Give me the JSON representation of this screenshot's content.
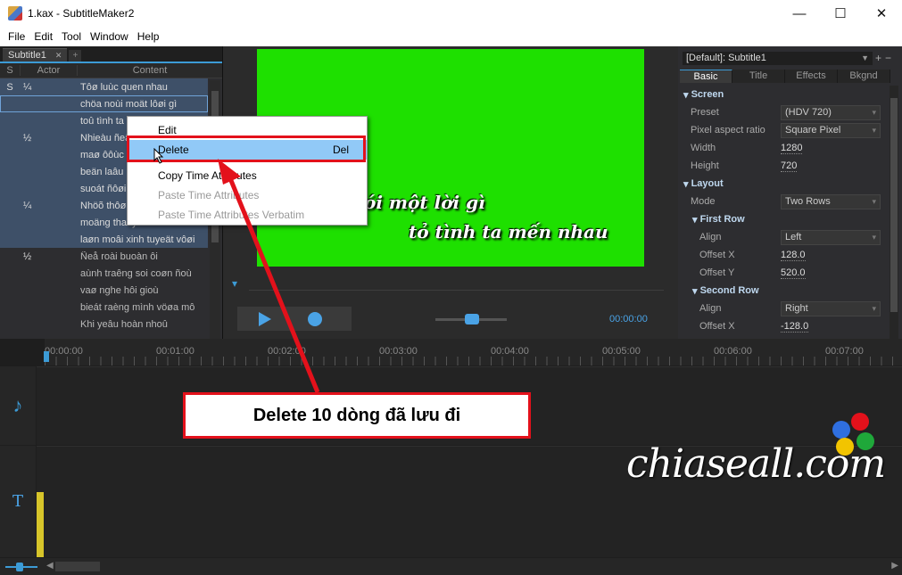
{
  "window": {
    "title": "1.kax - SubtitleMaker2",
    "minimize": "—",
    "maximize": "☐",
    "close": "✕"
  },
  "menu": [
    "File",
    "Edit",
    "Tool",
    "Window",
    "Help"
  ],
  "subtitle_tab": {
    "label": "Subtitle1",
    "close": "✕",
    "add": "+"
  },
  "grid": {
    "headers": {
      "s": "S",
      "actor": "Actor",
      "content": "Content"
    },
    "rows": [
      {
        "s": "S",
        "actor": "¼",
        "content": "Tôø luùc quen nhau",
        "state": "sel"
      },
      {
        "s": "",
        "actor": "",
        "content": "chöa noùi moät lôøi gì",
        "state": "cur"
      },
      {
        "s": "",
        "actor": "",
        "content": "toû tình ta m",
        "state": "sel"
      },
      {
        "s": "",
        "actor": "½",
        "content": "Nhieàu ñeâ",
        "state": "sel"
      },
      {
        "s": "",
        "actor": "",
        "content": "maø ôôùc",
        "state": "sel"
      },
      {
        "s": "",
        "actor": "",
        "content": "beän laâu",
        "state": "sel"
      },
      {
        "s": "",
        "actor": "",
        "content": "suoát ñôøi",
        "state": "sel"
      },
      {
        "s": "",
        "actor": "¼",
        "content": "Nhöõ thôøi",
        "state": "sel"
      },
      {
        "s": "",
        "actor": "",
        "content": "moäng thaáy ai maém cöôøi",
        "state": "sel"
      },
      {
        "s": "",
        "actor": "",
        "content": "laøn moâi xinh tuyeät vôøi",
        "state": "sel"
      },
      {
        "s": "",
        "actor": "½",
        "content": "Ñeå roài buoàn ôi",
        "state": "unsel"
      },
      {
        "s": "",
        "actor": "",
        "content": "aùnh traêng soi coøn ñoù",
        "state": "unsel"
      },
      {
        "s": "",
        "actor": "",
        "content": "vaø nghe hôi gioù",
        "state": "unsel"
      },
      {
        "s": "",
        "actor": "",
        "content": "bieát raèng mình vöøa mô",
        "state": "unsel"
      },
      {
        "s": "",
        "actor": "",
        "content": "Khi yeâu hoàn nhoû",
        "state": "unsel"
      }
    ]
  },
  "context_menu": {
    "items": [
      {
        "label": "Edit",
        "shortcut": "",
        "disabled": false
      },
      {
        "label": "Delete",
        "shortcut": "Del",
        "disabled": false,
        "highlighted": true
      },
      {
        "label": "Copy Time Attributes",
        "shortcut": "",
        "disabled": false
      },
      {
        "label": "Paste Time Attributes",
        "shortcut": "",
        "disabled": true
      },
      {
        "label": "Paste Time Attributes Verbatim",
        "shortcut": "",
        "disabled": true
      }
    ]
  },
  "video": {
    "subtitle_line1": "ói một lời gì",
    "subtitle_line2": "tỏ tình ta mến nhau",
    "time": "00:00:00"
  },
  "style_panel": {
    "style_name": "[Default]: Subtitle1",
    "tabs": [
      "Basic",
      "Title",
      "Effects",
      "Bkgnd"
    ],
    "active_tab": "Basic",
    "screen": {
      "section": "Screen",
      "preset_label": "Preset",
      "preset_value": "(HDV 720)",
      "par_label": "Pixel aspect ratio",
      "par_value": "Square Pixel",
      "width_label": "Width",
      "width_value": "1280",
      "height_label": "Height",
      "height_value": "720"
    },
    "layout": {
      "section": "Layout",
      "mode_label": "Mode",
      "mode_value": "Two Rows",
      "first_row": "First Row",
      "fr_align_label": "Align",
      "fr_align_value": "Left",
      "fr_offx_label": "Offset X",
      "fr_offx_value": "128.0",
      "fr_offy_label": "Offset Y",
      "fr_offy_value": "520.0",
      "second_row": "Second Row",
      "sr_align_label": "Align",
      "sr_align_value": "Right",
      "sr_offx_label": "Offset X",
      "sr_offx_value": "-128.0"
    }
  },
  "timeline": {
    "ticks": [
      "00:00:00",
      "00:01:00",
      "00:02:00",
      "00:03:00",
      "00:04:00",
      "00:05:00",
      "00:06:00",
      "00:07:00"
    ],
    "audio_icon": "♪",
    "text_icon": "T"
  },
  "annotation": {
    "text": "Delete 10 dòng đã lưu đi",
    "color": "#e3111b"
  },
  "watermark": {
    "text": "chiaseall.com",
    "dot_colors": [
      "#2f6fe0",
      "#e3111b",
      "#f2c400",
      "#1fa83a"
    ]
  },
  "colors": {
    "accent": "#3c9bd6",
    "video_bg": "#1ee000",
    "highlight": "#91c9f7"
  }
}
